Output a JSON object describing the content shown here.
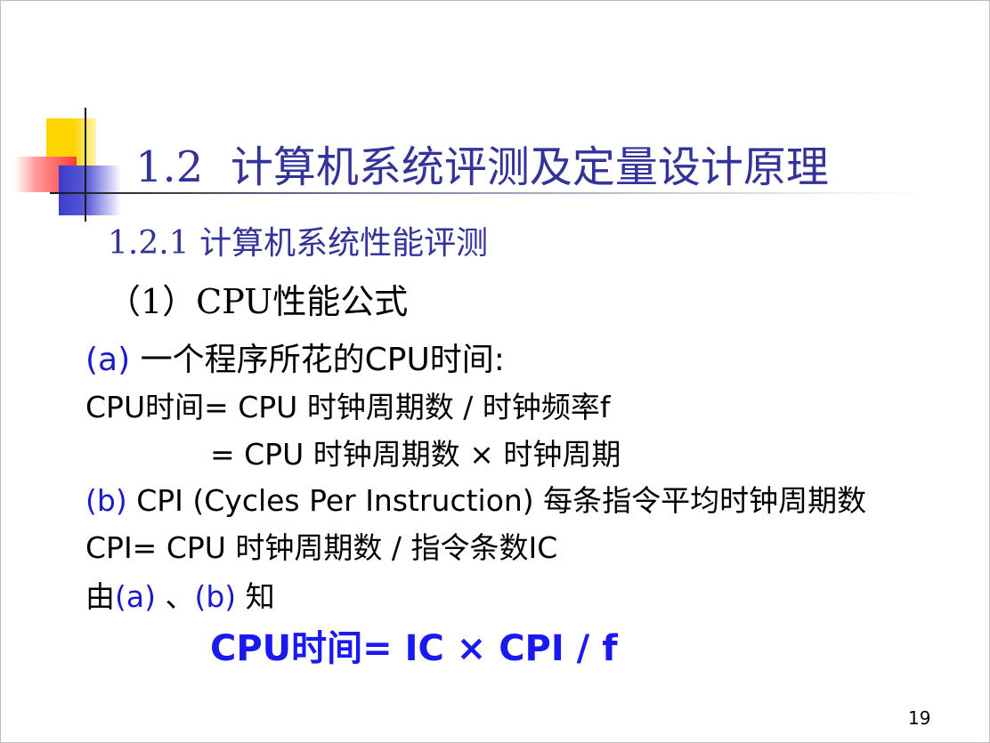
{
  "slide": {
    "title_number": "1.2",
    "title_text": "计算机系统评测及定量设计原理",
    "subtitle_number": "1.2.1",
    "subtitle_text": "计算机系统性能评测",
    "heading_number": "（1）CPU",
    "heading_text": "性能公式",
    "line_a_label": "(a)",
    "line_a_text": "一个程序所花的CPU时间:",
    "line_cpu_time_1": "CPU时间= CPU 时钟周期数 / 时钟频率f",
    "line_cpu_time_2": "= CPU 时钟周期数 × 时钟周期",
    "line_b_label": "(b)",
    "line_b_text": "CPI (Cycles Per Instruction) 每条指令平均时钟周期数",
    "line_cpi": "CPI= CPU 时钟周期数 / 指令条数IC",
    "line_from_prefix": "由",
    "line_from_a": "(a)",
    "line_from_sep": "、",
    "line_from_b": "(b)",
    "line_from_suffix": "知",
    "formula": "CPU时间= IC × CPI / f",
    "page_number": "19"
  },
  "colors": {
    "title": "#33339a",
    "label_blue": "#1a1acc",
    "formula_blue": "#1a1aee"
  }
}
